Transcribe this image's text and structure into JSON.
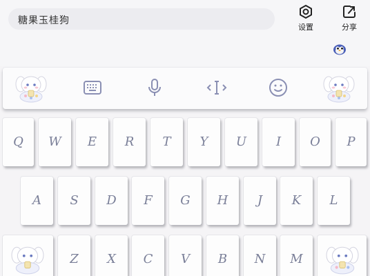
{
  "search": {
    "value": "糖果玉桂狗"
  },
  "top_actions": {
    "settings_label": "设置",
    "share_label": "分享"
  },
  "toolbar": {
    "icons": [
      "mascot-icon",
      "keyboard-icon",
      "microphone-icon",
      "cursor-icon",
      "emoji-icon",
      "mascot-icon"
    ]
  },
  "keyboard": {
    "row1": [
      "Q",
      "W",
      "E",
      "R",
      "T",
      "Y",
      "U",
      "I",
      "O",
      "P"
    ],
    "row2": [
      "A",
      "S",
      "D",
      "F",
      "G",
      "H",
      "J",
      "K",
      "L"
    ],
    "row3": [
      "Z",
      "X",
      "C",
      "V",
      "B",
      "N",
      "M"
    ]
  },
  "colors": {
    "key_text": "#7a7f98",
    "icon": "#8a8fb3",
    "background": "#f5f4f6"
  }
}
